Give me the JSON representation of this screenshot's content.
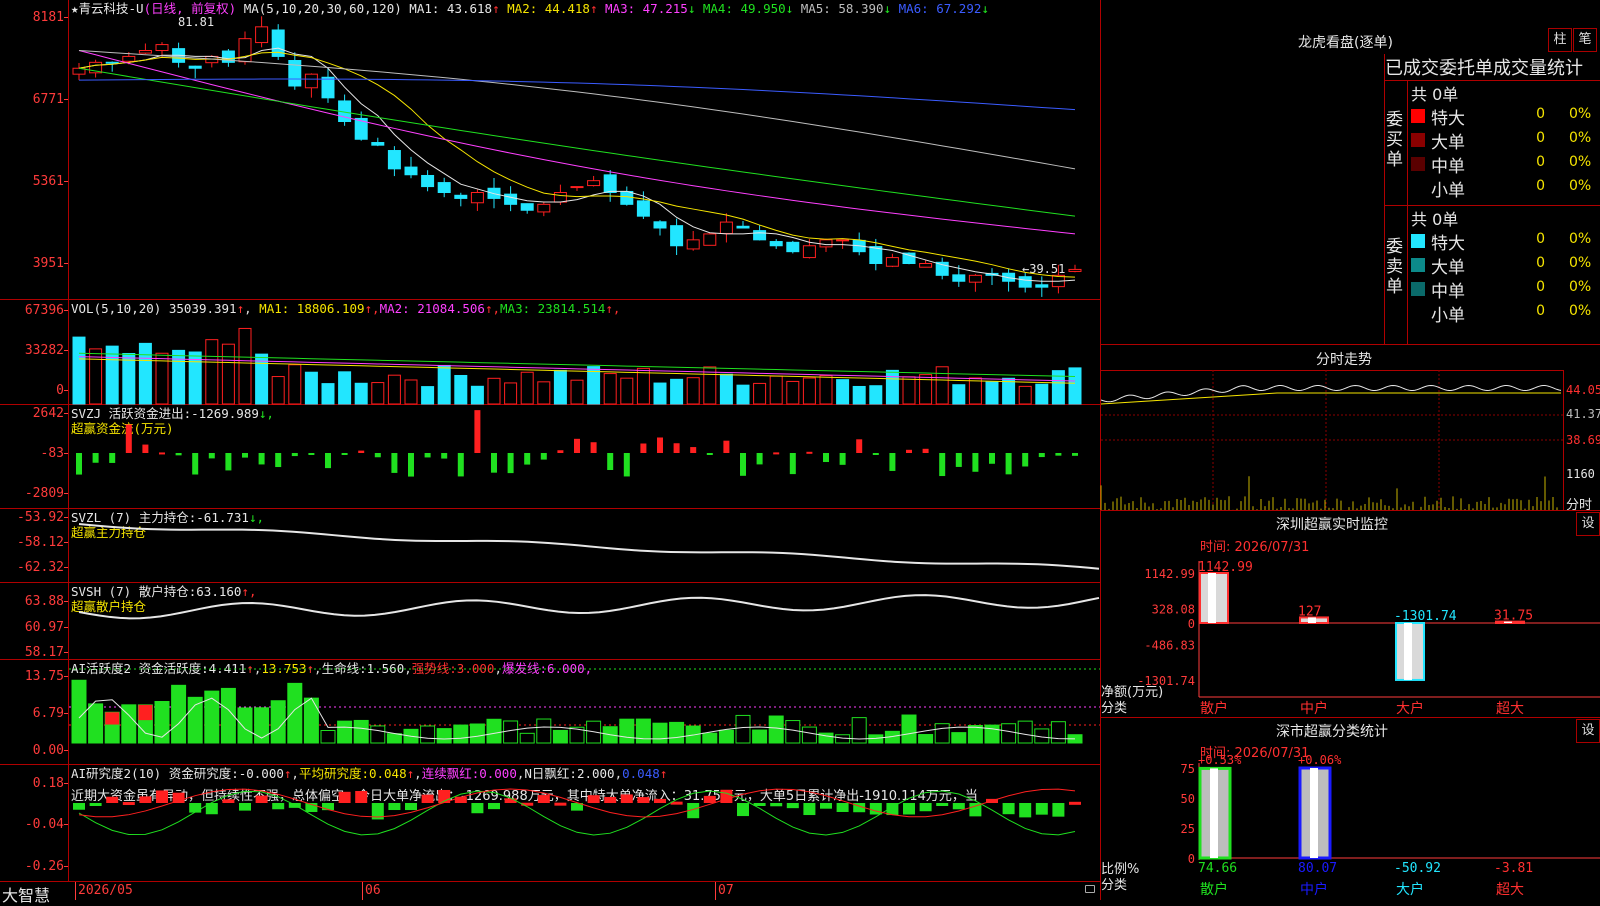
{
  "app": {
    "brand": "大智慧"
  },
  "main": {
    "title": "★青云科技-U",
    "period": "(日线, 前复权)",
    "ma_label": "MA(5,10,20,30,60,120)",
    "ma": [
      {
        "name": "MA1:",
        "value": "43.618",
        "arrow": "↑",
        "color": "#e6e6e6"
      },
      {
        "name": "MA2:",
        "value": "44.418",
        "arrow": "↑",
        "color": "#f5e400"
      },
      {
        "name": "MA3:",
        "value": "47.215",
        "arrow": "↓",
        "color": "#ff40ff"
      },
      {
        "name": "MA4:",
        "value": "49.950",
        "arrow": "↓",
        "color": "#20e020"
      },
      {
        "name": "MA5:",
        "value": "58.390",
        "arrow": "↓",
        "color": "#bdbdbd"
      },
      {
        "name": "MA6:",
        "value": "67.292",
        "arrow": "↓",
        "color": "#3b5cff"
      }
    ],
    "ylabels": [
      "8181",
      "6771",
      "5361",
      "3951"
    ],
    "high_mark": "81.81",
    "low_mark": "←39.51"
  },
  "vol": {
    "label": "VOL(5,10,20)",
    "value": "35039.391",
    "ma": [
      {
        "name": "MA1:",
        "value": "18806.109",
        "arrow": "↑",
        "color": "#f5e400"
      },
      {
        "name": "MA2:",
        "value": "21084.506",
        "arrow": "↑",
        "color": "#ff40ff"
      },
      {
        "name": "MA3:",
        "value": "23814.514",
        "arrow": "↑",
        "color": "#20e020"
      }
    ],
    "ylabels": [
      "67396",
      "33282",
      "0"
    ]
  },
  "svzj": {
    "label": "SVZJ  活跃资金进出:",
    "value": "-1269.989",
    "arrow": "↓,",
    "sub": "超赢资金流(万元)",
    "ylabels": [
      "2642",
      "-83",
      "-2809"
    ]
  },
  "svzl": {
    "label": "SVZL (7) 主力持仓:",
    "value": "-61.731",
    "arrow": "↓,",
    "sub": "超赢主力持仓",
    "ylabels": [
      "-53.92",
      "-58.12",
      "-62.32"
    ]
  },
  "svsh": {
    "label": "SVSH (7) 散户持仓:",
    "value": "63.160",
    "arrow": "↑,",
    "sub": "超赢散户持仓",
    "ylabels": [
      "63.88",
      "60.97",
      "58.17"
    ]
  },
  "ai1": {
    "label": "AI活跃度2 资金活跃度:",
    "v1": "4.411",
    "v1a": "↑",
    "v2": "13.753",
    "v2a": "↑",
    "life": "生命线:",
    "life_v": "1.560",
    "strong": "强势线:",
    "strong_v": "3.000",
    "burst": "爆发线:",
    "burst_v": "6.000,",
    "ylabels": [
      "13.75",
      "6.79",
      "0.00"
    ]
  },
  "ai2": {
    "label": "AI研究度2(10) 资金研究度:",
    "v1": "-0.000",
    "v1a": "↑",
    "avg": "平均研究度:",
    "avg_v": "0.048",
    "avg_a": "↑",
    "lx": "连续飘红:",
    "lx_v": "0.000",
    "nday": "N日飘红:",
    "nday_v": "2.000",
    "last": "0.048",
    "last_a": "↑",
    "text": "近期大资金虽有异动，但持续性不强，总体偏空，今日大单净流出：-1269.988万元，其中特大单净流入：31.75万元，大单5日累计净出-1910.114万元，当",
    "ylabels": [
      "0.18",
      "-0.04",
      "-0.26"
    ]
  },
  "xaxis": {
    "labels": [
      "2026/05",
      "06",
      "07"
    ]
  },
  "right": {
    "lhb_title": "龙虎看盘(逐单)",
    "btn_zhu": "柱",
    "btn_bi": "笔",
    "stat_title": "已成交委托单成交量统计",
    "buy_side": "委买单",
    "sell_side": "委卖单",
    "buy_total": "共 0单",
    "sell_total": "共 0单",
    "buy_rows": [
      {
        "label": "特大",
        "count": "0",
        "pct": "0%",
        "color": "#ff0000"
      },
      {
        "label": "大单",
        "count": "0",
        "pct": "0%",
        "color": "#8b0000"
      },
      {
        "label": "中单",
        "count": "0",
        "pct": "0%",
        "color": "#5a0000"
      },
      {
        "label": "小单",
        "count": "0",
        "pct": "0%",
        "color": "#000000"
      }
    ],
    "sell_rows": [
      {
        "label": "特大",
        "count": "0",
        "pct": "0%",
        "color": "#22e6ff"
      },
      {
        "label": "大单",
        "count": "0",
        "pct": "0%",
        "color": "#0c8a8a"
      },
      {
        "label": "中单",
        "count": "0",
        "pct": "0%",
        "color": "#0a6a6a"
      },
      {
        "label": "小单",
        "count": "0",
        "pct": "0%",
        "color": "#000000"
      }
    ],
    "intraday_title": "分时走势",
    "intraday_y": [
      "44.05",
      "41.37",
      "38.69",
      "1160"
    ],
    "intraday_unit": "分时",
    "sz_title": "深圳超赢实时监控",
    "sz_btn": "设",
    "sz_time": "时间: 2026/07/31",
    "sz_ylabels": [
      "1142.99",
      "328.08",
      "0",
      "-486.83",
      "-1301.74"
    ],
    "sz_bars": [
      {
        "cat": "散户",
        "label": "1142.99",
        "value": 1142.99,
        "color": "#e6e6e6",
        "lcolor": "#ff3030"
      },
      {
        "cat": "中户",
        "label": "127",
        "value": 127,
        "color": "#e6e6e6",
        "lcolor": "#ff3030"
      },
      {
        "cat": "大户",
        "label": "-1301.74",
        "value": -1301.74,
        "color": "#e6e6e6",
        "lcolor": "#22e6ff"
      },
      {
        "cat": "超大",
        "label": "31.75",
        "value": 31.75,
        "color": "#e6e6e6",
        "lcolor": "#ff3030"
      }
    ],
    "sz_unit1": "净额(万元)",
    "sz_unit2": "分类",
    "cls_title": "深市超赢分类统计",
    "cls_btn": "设",
    "cls_time": "时间: 2026/07/31",
    "cls_ylabels": [
      "75",
      "50",
      "25",
      "0"
    ],
    "cls_top": [
      "+0.53%",
      "+0.06%"
    ],
    "cls_bottom": [
      "74.66",
      "80.07",
      "-50.92",
      "-3.81"
    ],
    "cls_cats": [
      "散户",
      "中户",
      "大户",
      "超大"
    ],
    "cls_unit1": "比例%",
    "cls_unit2": "分类"
  }
}
